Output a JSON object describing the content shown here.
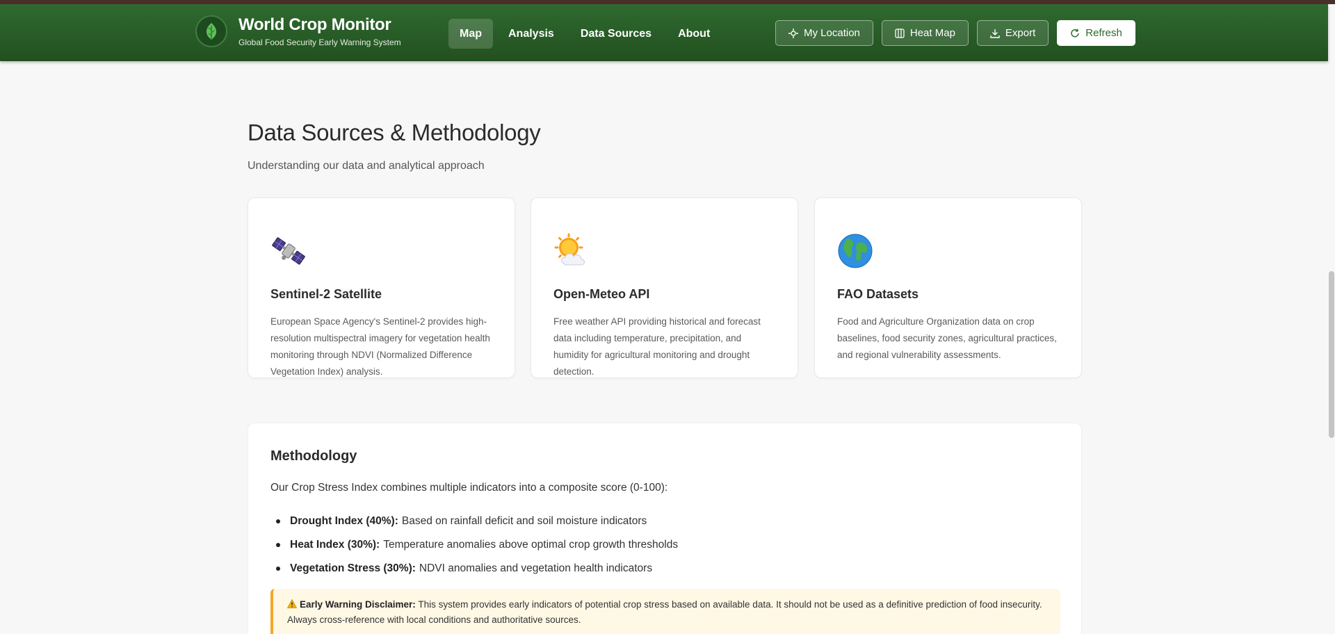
{
  "app": {
    "title": "World Crop Monitor",
    "subtitle": "Global Food Security Early Warning System"
  },
  "nav": {
    "items": [
      {
        "label": "Map",
        "active": true
      },
      {
        "label": "Analysis",
        "active": false
      },
      {
        "label": "Data Sources",
        "active": false
      },
      {
        "label": "About",
        "active": false
      }
    ]
  },
  "toolbar": {
    "my_location": "My Location",
    "heat_map": "Heat Map",
    "export": "Export",
    "refresh": "Refresh"
  },
  "page": {
    "title": "Data Sources & Methodology",
    "subtitle": "Understanding our data and analytical approach"
  },
  "cards": [
    {
      "icon": "satellite-icon",
      "title": "Sentinel-2 Satellite",
      "description": "European Space Agency's Sentinel-2 provides high-resolution multispectral imagery for vegetation health monitoring through NDVI (Normalized Difference Vegetation Index) analysis."
    },
    {
      "icon": "sun-behind-cloud-icon",
      "title": "Open-Meteo API",
      "description": "Free weather API providing historical and forecast data including temperature, precipitation, and humidity for agricultural monitoring and drought detection."
    },
    {
      "icon": "globe-icon",
      "title": "FAO Datasets",
      "description": "Food and Agriculture Organization data on crop baselines, food security zones, agricultural practices, and regional vulnerability assessments."
    }
  ],
  "methodology": {
    "title": "Methodology",
    "intro": "Our Crop Stress Index combines multiple indicators into a composite score (0-100):",
    "items": [
      {
        "label": "Drought Index (40%):",
        "text": "Based on rainfall deficit and soil moisture indicators"
      },
      {
        "label": "Heat Index (30%):",
        "text": "Temperature anomalies above optimal crop growth thresholds"
      },
      {
        "label": "Vegetation Stress (30%):",
        "text": "NDVI anomalies and vegetation health indicators"
      }
    ],
    "disclaimer": {
      "icon": "warning-icon",
      "label": "Early Warning Disclaimer:",
      "text": "This system provides early indicators of potential crop stress based on available data. It should not be used as a definitive prediction of food insecurity. Always cross-reference with local conditions and authoritative sources."
    }
  },
  "colors": {
    "header_green": "#2f6a30",
    "accent_amber": "#f4a72a",
    "disclaimer_bg": "#fff8e5"
  }
}
